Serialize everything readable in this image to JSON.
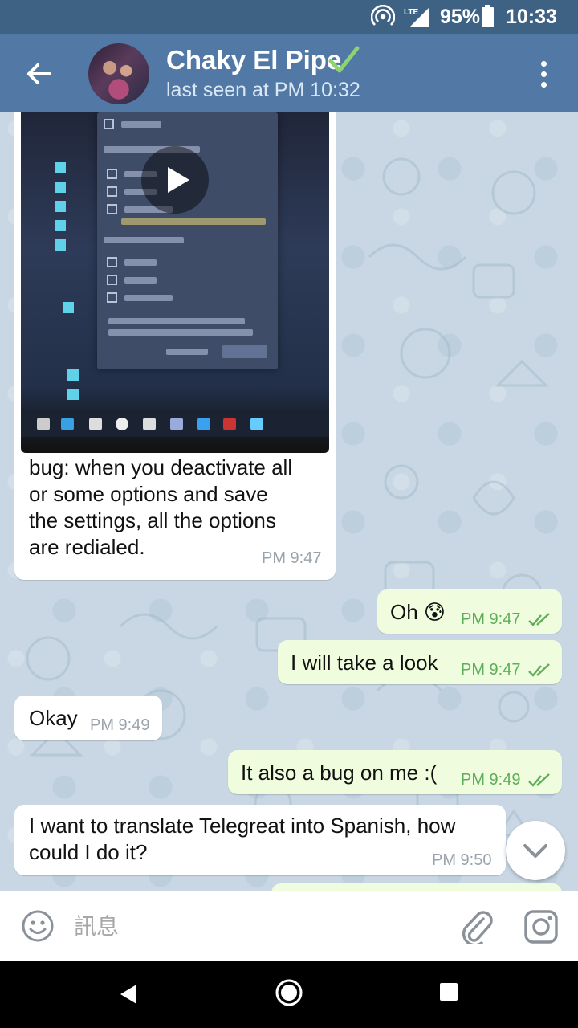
{
  "status_bar": {
    "network": "LTE",
    "battery": "95%",
    "time": "10:33"
  },
  "header": {
    "title": "Chaky El Pipe",
    "subtitle": "last seen at PM 10:32",
    "colors": {
      "app_bar": "#5279a6",
      "status_bar": "#3d6284",
      "verified": "#8ed36f"
    }
  },
  "messages": [
    {
      "direction": "in",
      "type": "video",
      "text": "bug: when you deactivate all or some options and save the settings, all the options are redialed.",
      "lines": [
        "bug: when you deactivate all",
        "or some options and save",
        "the settings, all the options",
        "are redialed."
      ],
      "time": "PM 9:47"
    },
    {
      "direction": "out",
      "text": "Oh 😰",
      "time": "PM 9:47",
      "read": true
    },
    {
      "direction": "out",
      "text": "I will take a look",
      "time": "PM 9:47",
      "read": true
    },
    {
      "direction": "in",
      "text": "Okay",
      "time": "PM 9:49"
    },
    {
      "direction": "out",
      "text": "It also a bug on me :(",
      "time": "PM 9:49",
      "read": true
    },
    {
      "direction": "in",
      "text": "I want to translate Telegreat into Spanish, how could I do it?",
      "lines": [
        "I want to translate Telegreat into Spanish, how",
        "could I do it?"
      ],
      "time": "PM 9:50"
    }
  ],
  "composer": {
    "placeholder": "訊息"
  },
  "icons": {
    "back": "arrow-left-icon",
    "menu": "more-vertical-icon",
    "emoji": "smile-icon",
    "attach": "paperclip-icon",
    "camera": "instagram-camera-icon",
    "scroll": "chevron-down-icon",
    "play": "play-icon"
  }
}
